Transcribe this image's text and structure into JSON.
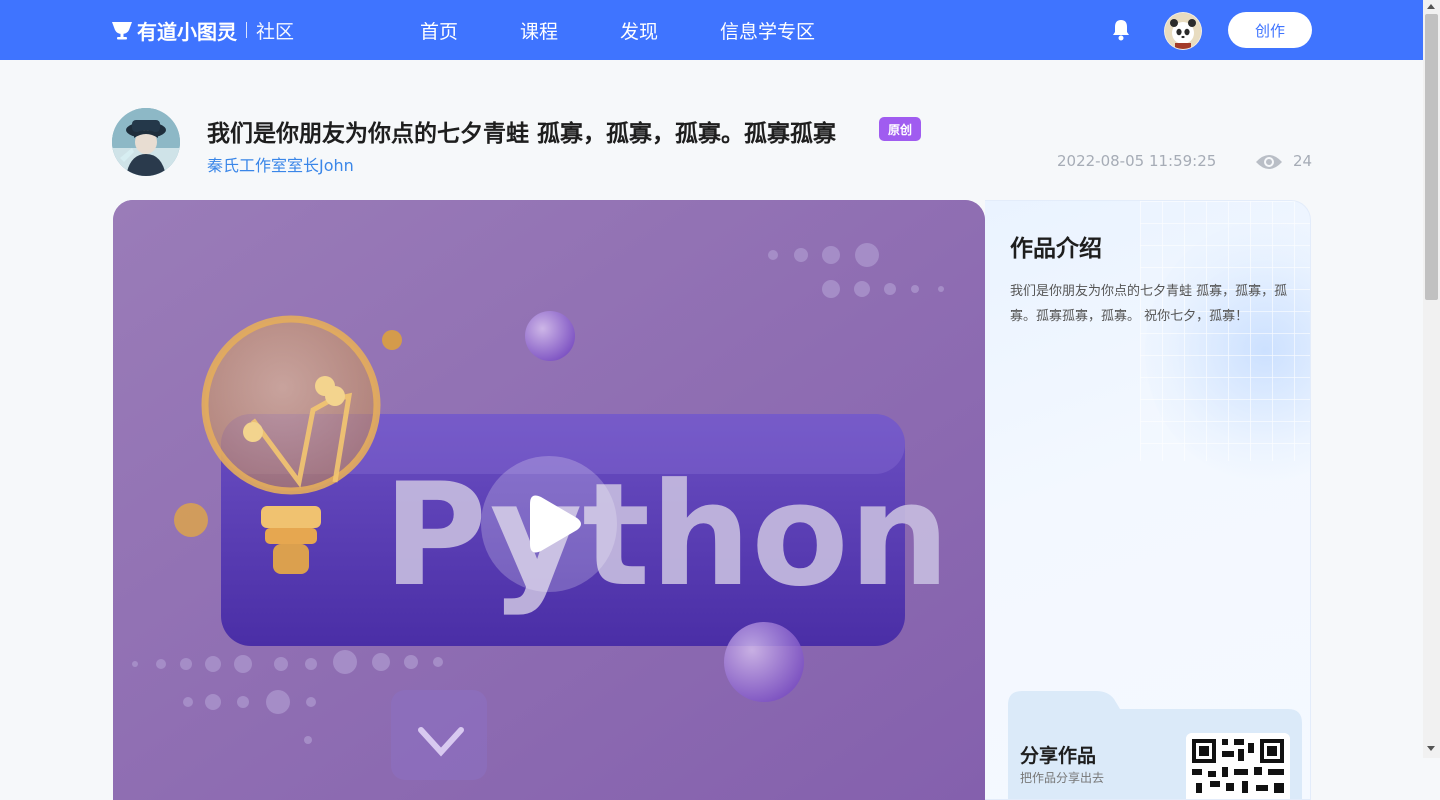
{
  "brand": {
    "name": "有道小图灵",
    "sub": "社区"
  },
  "nav": {
    "home": "首页",
    "course": "课程",
    "discover": "发现",
    "info": "信息学专区"
  },
  "header": {
    "create_label": "创作"
  },
  "work": {
    "title": "我们是你朋友为你点的七夕青蛙 孤寡，孤寡，孤寡。孤寡孤寡",
    "badge": "原创",
    "author": "秦氏工作室室长John",
    "datetime": "2022-08-05 11:59:25",
    "views": "24"
  },
  "video": {
    "cover_text": "Python"
  },
  "intro": {
    "title": "作品介绍",
    "text": "我们是你朋友为你点的七夕青蛙 孤寡，孤寡，孤寡。孤寡孤寡，孤寡。 祝你七夕，孤寡！"
  },
  "share": {
    "title": "分享作品",
    "subtitle": "把作品分享出去"
  },
  "colors": {
    "accent": "#3f74ff",
    "badge": "#a05cf0",
    "author_link": "#3a86e8"
  }
}
